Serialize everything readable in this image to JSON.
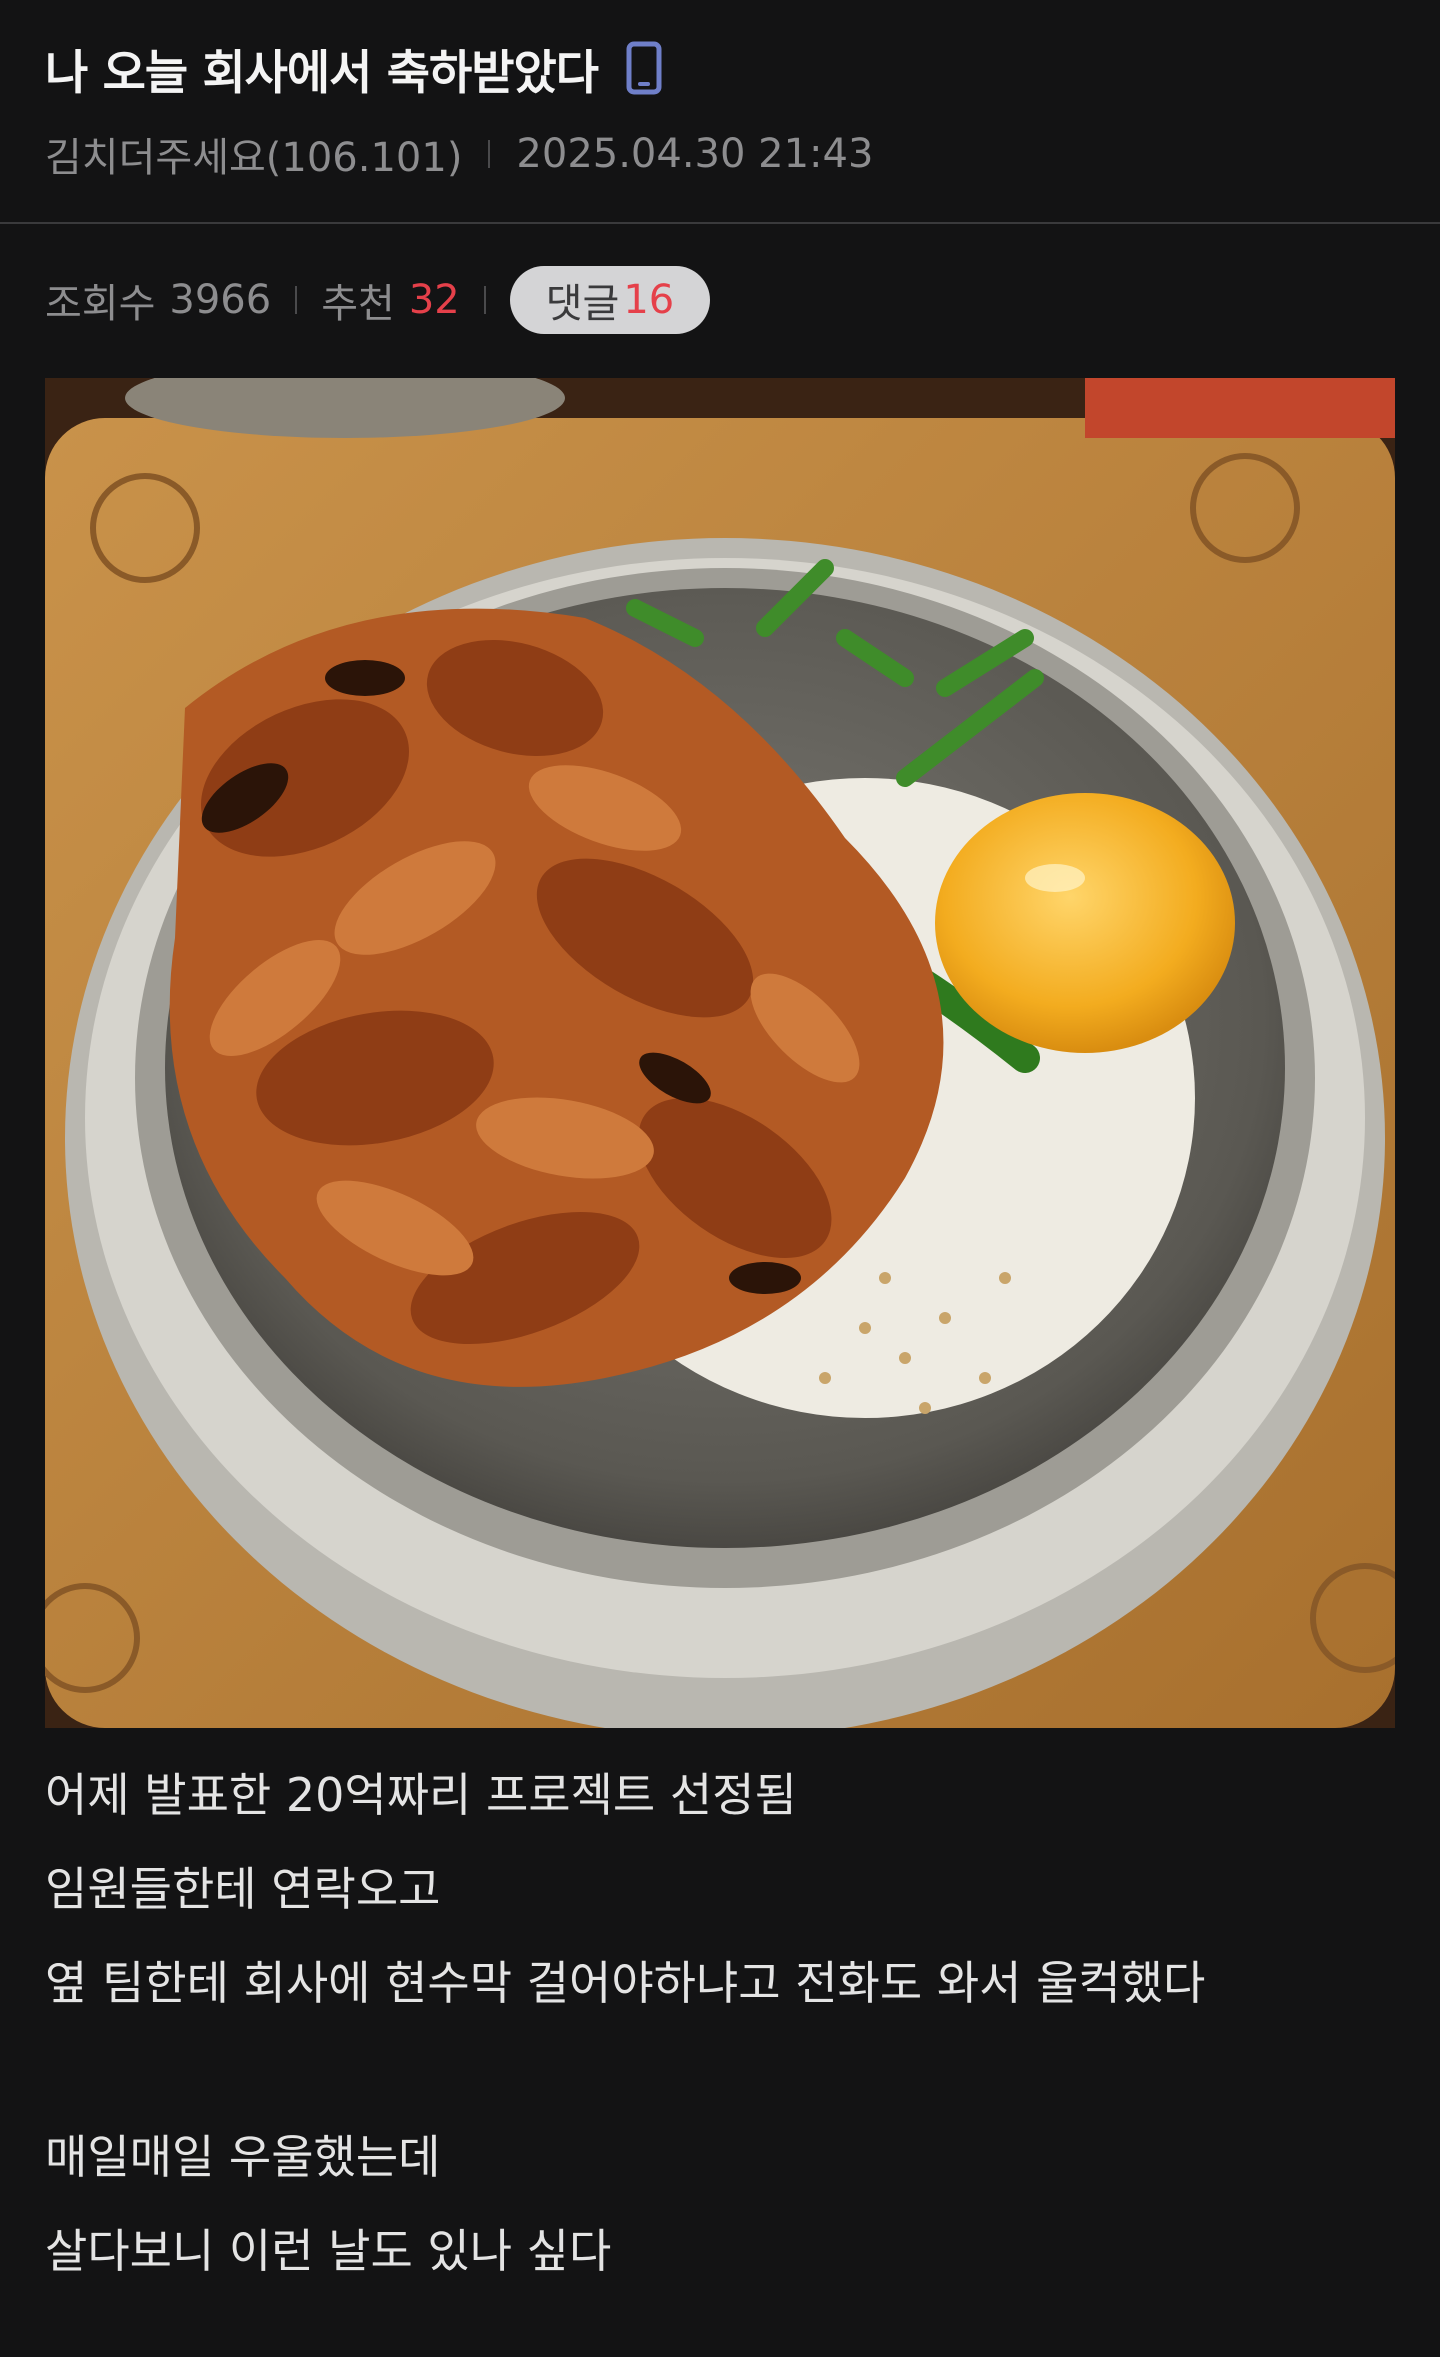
{
  "post": {
    "title": "나 오늘 회사에서 축하받았다",
    "device_icon": "mobile-phone-icon",
    "author": "김치더주세요(106.101)",
    "datetime": "2025.04.30 21:43",
    "views_label": "조회수",
    "views_value": "3966",
    "recommend_label": "추천",
    "recommend_value": "32",
    "comments_label": "댓글",
    "comments_value": "16",
    "image_subject": "food-photo",
    "body": {
      "line1": "어제 발표한 20억짜리 프로젝트 선정됨",
      "line2": "임원들한테 연락오고",
      "line3": "옆 팀한테 회사에 현수막 걸어야하냐고 전화도 와서 울컥했다",
      "line4": "매일매일 우울했는데",
      "line5": "살다보니 이런 날도 있나 싶다"
    }
  },
  "colors": {
    "background": "#131314",
    "accent_red": "#e5404a",
    "muted": "#8d8d8f",
    "comment_pill": "#d4d4d6"
  }
}
